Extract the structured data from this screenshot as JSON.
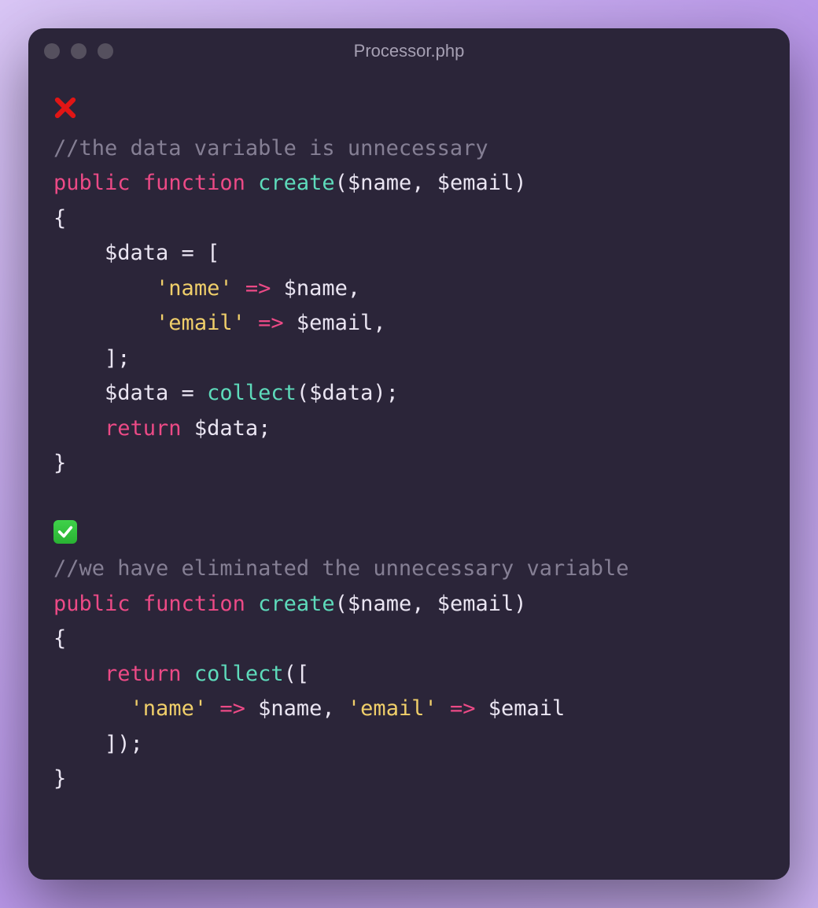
{
  "window": {
    "title": "Processor.php"
  },
  "markers": {
    "bad_label": "cross-icon",
    "good_label": "check-icon"
  },
  "bad": {
    "comment": "//the data variable is unnecessary",
    "line1": {
      "pub": "public",
      "func": "function",
      "name": "create",
      "args": "($name, $email)"
    },
    "brace_open": "{",
    "assign_open": "    $data = [",
    "kv_name": {
      "key": "'name'",
      "arrow": "=>",
      "val": " $name,"
    },
    "kv_email": {
      "key": "'email'",
      "arrow": "=>",
      "val": " $email,"
    },
    "arr_close": "    ];",
    "collect": {
      "prefix": "    $data = ",
      "fn": "collect",
      "args": "($data);"
    },
    "ret": {
      "kw": "return",
      "val": " $data;"
    },
    "brace_close": "}"
  },
  "good": {
    "comment": "//we have eliminated the unnecessary variable",
    "line1": {
      "pub": "public",
      "func": "function",
      "name": "create",
      "args": "($name, $email)"
    },
    "brace_open": "{",
    "ret_open": {
      "kw": "return",
      "sp": " ",
      "fn": "collect",
      "open": "(["
    },
    "kv": {
      "k1": "'name'",
      "a1": "=>",
      "v1": " $name, ",
      "k2": "'email'",
      "a2": "=>",
      "v2": " $email"
    },
    "close": "    ]);",
    "brace_close": "}"
  }
}
